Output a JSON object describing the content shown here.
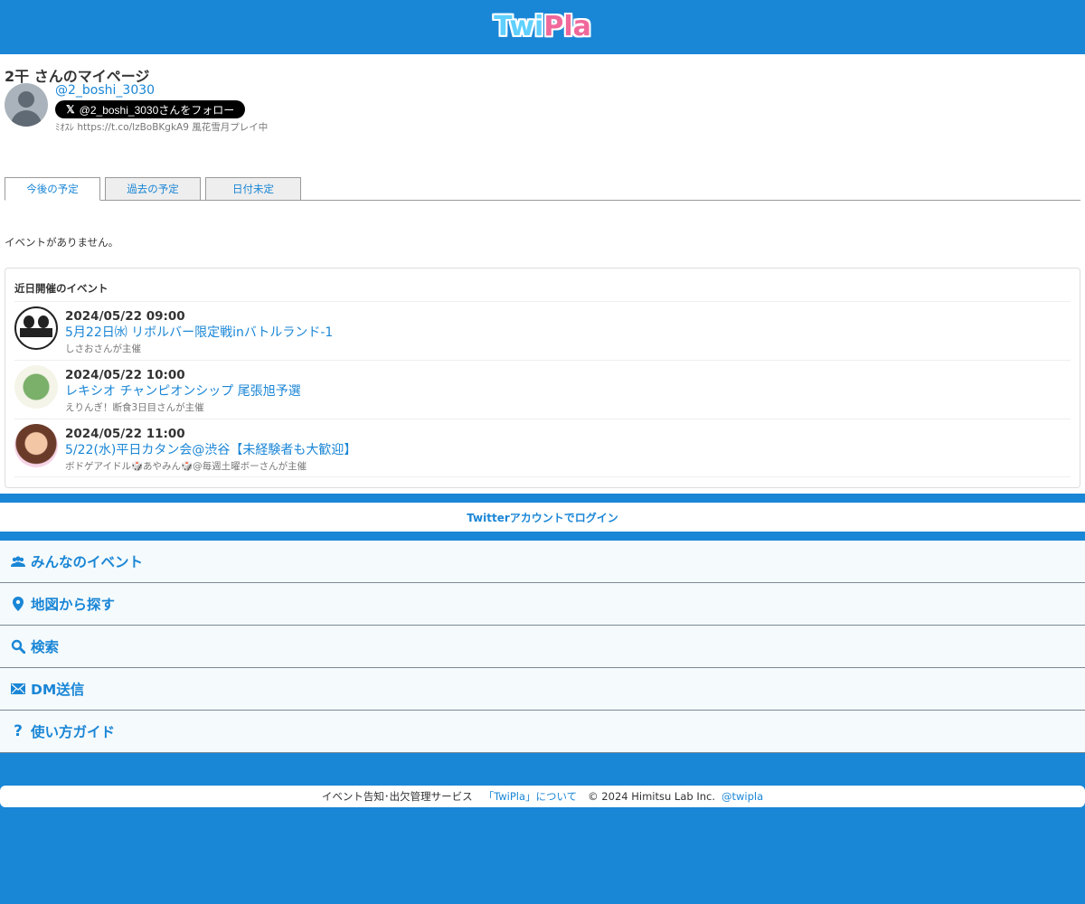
{
  "header": {
    "logo_twi": "Twi",
    "logo_pla": "Pla"
  },
  "profile": {
    "page_title": "2干 さんのマイページ",
    "handle": "@2_boshi_3030",
    "follow_label": "@2_boshi_3030さんをフォロー",
    "bio": "ﾐｵｽﾚ https://t.co/lzBoBKgkA9 風花雪月プレイ中"
  },
  "tabs": [
    "今後の予定",
    "過去の予定",
    "日付未定"
  ],
  "no_events": "イベントがありません。",
  "recent": {
    "title": "近日開催のイベント",
    "events": [
      {
        "date": "2024/05/22 09:00",
        "title": "5月22日㈬ リボルバー限定戦inバトルランド-1",
        "host": "しさおさんが主催"
      },
      {
        "date": "2024/05/22 10:00",
        "title": "レキシオ チャンピオンシップ 尾張旭予選",
        "host": "えりんぎ！断食3日目さんが主催"
      },
      {
        "date": "2024/05/22 11:00",
        "title": "5/22(水)平日カタン会@渋谷【未経験者も大歓迎】",
        "host": "ボドゲアイドル🎲あやみん🎲@毎週土曜ボーさんが主催"
      }
    ]
  },
  "login": "Twitterアカウントでログイン",
  "nav": [
    "みんなのイベント",
    "地図から探す",
    "検索",
    "DM送信",
    "使い方ガイド"
  ],
  "footer": {
    "service": "イベント告知･出欠管理サービス",
    "about": "「TwiPla」について",
    "copyright": "© 2024 Himitsu Lab Inc.",
    "twitter": "@twipla"
  }
}
